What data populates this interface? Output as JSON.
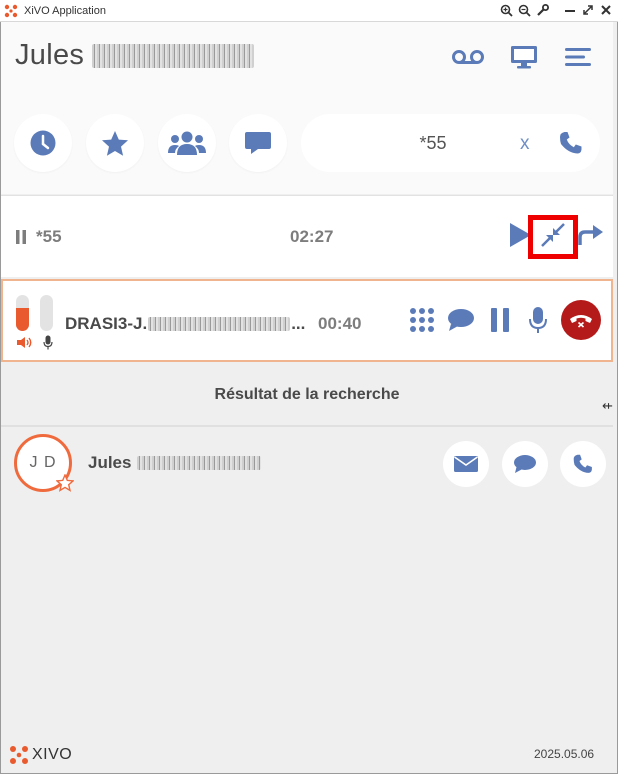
{
  "window": {
    "title": "XiVO Application"
  },
  "header": {
    "user_name": "Jules",
    "voicemail_icon": "voicemail-icon",
    "screen_icon": "monitor-icon",
    "menu_icon": "menu-icon"
  },
  "toolbar": {
    "history_icon": "clock-icon",
    "favorites_icon": "star-icon",
    "contacts_icon": "users-icon",
    "chat_icon": "chat-icon",
    "search_value": "*55",
    "clear_label": "x"
  },
  "held_call": {
    "number": "*55",
    "duration": "02:27"
  },
  "active_call": {
    "caller_prefix": "DRASI3-J.",
    "caller_suffix": "...",
    "duration": "00:40",
    "speaker_level": 0.65,
    "mic_level": 0.0
  },
  "results": {
    "heading": "Résultat de la recherche",
    "contacts": [
      {
        "initials": "J D",
        "name": "Jules"
      }
    ]
  },
  "footer": {
    "brand": "XIVO",
    "version": "2025.05.06"
  },
  "colors": {
    "accent_blue": "#5b7bb8",
    "accent_orange": "#e95a2e",
    "hangup_red": "#b51a1a",
    "highlight_red": "#ee0000"
  }
}
